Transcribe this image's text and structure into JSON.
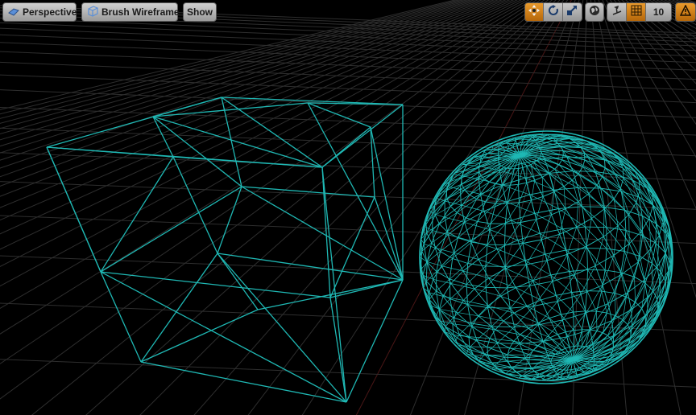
{
  "toolbar_left": {
    "perspective_label": "Perspective",
    "view_mode_label": "Brush Wireframe",
    "show_label": "Show"
  },
  "toolbar_right": {
    "transform_tools": [
      {
        "name": "translate-icon",
        "active": true
      },
      {
        "name": "rotate-icon",
        "active": false
      },
      {
        "name": "scale-icon",
        "active": false
      }
    ],
    "coordinate_system_icon": "world-globe-icon",
    "surface_snapping_icon": "surface-snap-icon",
    "grid_snap_icon": "grid-snap-icon",
    "grid_snap_value": "10",
    "warning_icon": "warning-icon"
  },
  "scene": {
    "wire_color": "#1fb8b4",
    "grid_color": "#2e2e2e",
    "x_axis_color": "#4a1616",
    "y_axis_color": "#163a16",
    "accent_color": "#d08418"
  }
}
